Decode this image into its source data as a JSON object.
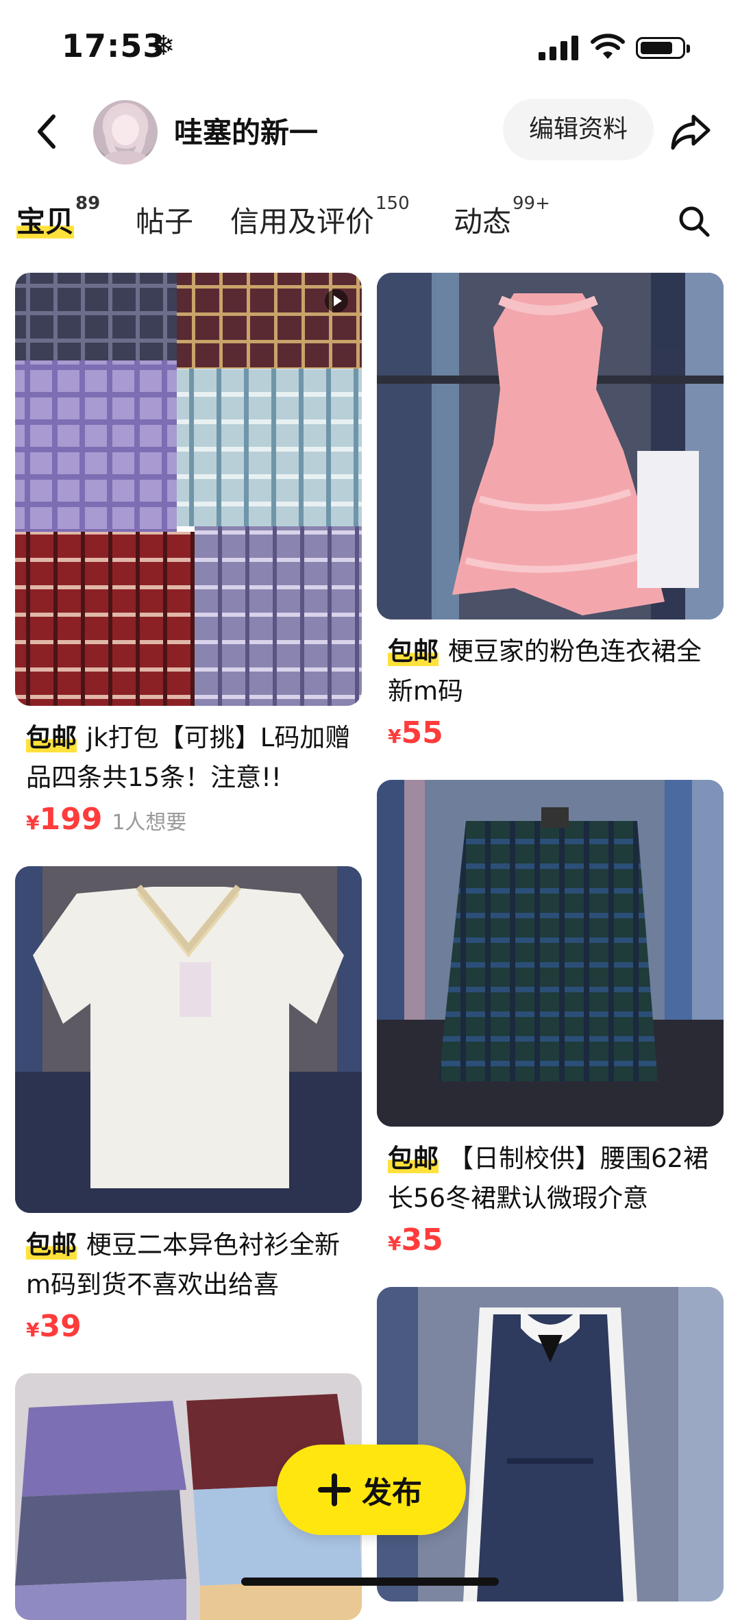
{
  "status": {
    "time": "17:53",
    "weather_icon": "snowflake-icon"
  },
  "nav": {
    "shop_name": "哇塞的新一",
    "edit_label": "编辑资料"
  },
  "tabs": [
    {
      "label": "宝贝",
      "count": "89",
      "active": true
    },
    {
      "label": "帖子",
      "count": ""
    },
    {
      "label": "信用及评价",
      "count": "150"
    },
    {
      "label": "动态",
      "count": "99+"
    }
  ],
  "items": [
    {
      "tag": "包邮",
      "title": "jk打包【可挑】L码加赠品四条共15条！注意!!",
      "currency": "¥",
      "price": "199",
      "wants": "1人想要"
    },
    {
      "tag": "包邮",
      "title": "梗豆家的粉色连衣裙全新m码",
      "currency": "¥",
      "price": "55",
      "wants": ""
    },
    {
      "tag": "包邮",
      "title": "梗豆二本异色衬衫全新m码到货不喜欢出给喜",
      "currency": "¥",
      "price": "39",
      "wants": ""
    },
    {
      "tag": "包邮",
      "title": "【日制校供】腰围62裙长56冬裙默认微瑕介意",
      "currency": "¥",
      "price": "35",
      "wants": ""
    }
  ],
  "fab": {
    "label": "发布"
  },
  "colors": {
    "accent": "#ffe60f",
    "highlight": "#ffe13b",
    "price": "#ff3b3b"
  }
}
